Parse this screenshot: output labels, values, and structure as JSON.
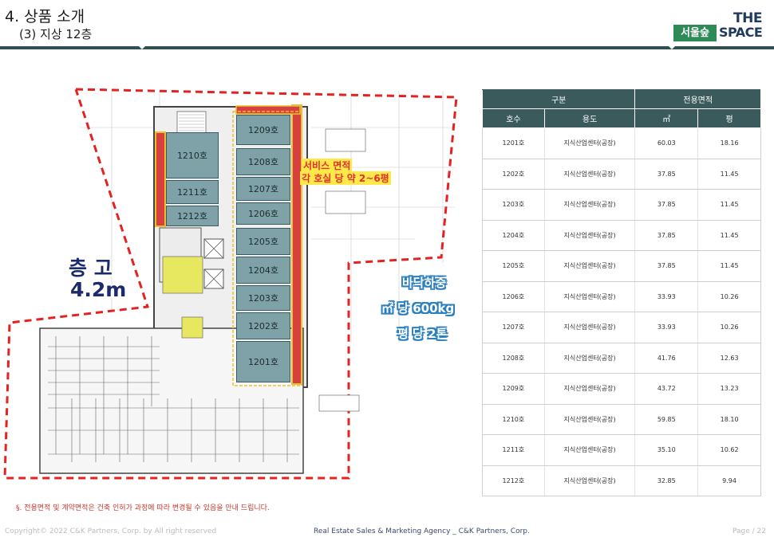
{
  "header": {
    "title": "4. 상품 소개",
    "subtitle": "(3) 지상 12층",
    "logo_brand": "서울숲",
    "logo_the": "THE",
    "logo_space": "SPACE"
  },
  "plan": {
    "ceiling_label": "층 고",
    "ceiling_value": "4.2m",
    "service_line1": "서비스 면적",
    "service_line2": "각 호실 당 약 2~6평",
    "load_line1": "바닥하중",
    "load_line2": "㎡ 당 600kg",
    "load_line3": "평 당 2톤",
    "rooms_right": [
      "1209호",
      "1208호",
      "1207호",
      "1206호",
      "1205호",
      "1204호",
      "1203호",
      "1202호",
      "1201호"
    ],
    "rooms_left": [
      "1210호",
      "1211호",
      "1212호"
    ]
  },
  "table": {
    "group_headers": [
      "구분",
      "전용면적"
    ],
    "columns": [
      "호수",
      "용도",
      "㎡",
      "평"
    ],
    "rows": [
      [
        "1201호",
        "지식산업센터(공장)",
        "60.03",
        "18.16"
      ],
      [
        "1202호",
        "지식산업센터(공장)",
        "37.85",
        "11.45"
      ],
      [
        "1203호",
        "지식산업센터(공장)",
        "37.85",
        "11.45"
      ],
      [
        "1204호",
        "지식산업센터(공장)",
        "37.85",
        "11.45"
      ],
      [
        "1205호",
        "지식산업센터(공장)",
        "37.85",
        "11.45"
      ],
      [
        "1206호",
        "지식산업센터(공장)",
        "33.93",
        "10.26"
      ],
      [
        "1207호",
        "지식산업센터(공장)",
        "33.93",
        "10.26"
      ],
      [
        "1208호",
        "지식산업센터(공장)",
        "41.76",
        "12.63"
      ],
      [
        "1209호",
        "지식산업센터(공장)",
        "43.72",
        "13.23"
      ],
      [
        "1210호",
        "지식산업센터(공장)",
        "59.85",
        "18.10"
      ],
      [
        "1211호",
        "지식산업센터(공장)",
        "35.10",
        "10.62"
      ],
      [
        "1212호",
        "지식산업센터(공장)",
        "32.85",
        "9.94"
      ]
    ]
  },
  "footer": {
    "note": "§. 전용면적 및 계약면적은 건축 인허가 과정에 따라 변경될 수 있음을 안내 드립니다.",
    "copyright": "Copyright© 2022 C&K Partners, Corp. by  All right reserved",
    "agency": "Real Estate Sales & Marketing Agency _ C&K Partners, Corp.",
    "page": "Page / 22"
  }
}
